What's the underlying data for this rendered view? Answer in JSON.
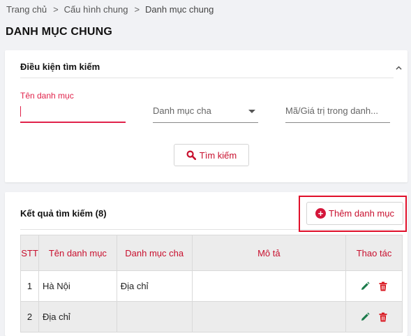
{
  "breadcrumb": {
    "home": "Trang chủ",
    "config": "Cấu hình chung",
    "current": "Danh mục chung",
    "separator": ">"
  },
  "page_title": "DANH MỤC CHUNG",
  "search": {
    "section_title": "Điều kiện tìm kiếm",
    "name_label": "Tên danh mục",
    "name_value": "",
    "parent_placeholder": "Danh mục cha",
    "code_placeholder": "Mã/Giá trị trong danh...",
    "search_button": "Tìm kiếm"
  },
  "results": {
    "title": "Kết quả tìm kiếm (8)",
    "add_button": "Thêm danh mục",
    "columns": [
      "STT",
      "Tên danh mục",
      "Danh mục cha",
      "Mô tả",
      "Thao tác"
    ],
    "rows": [
      {
        "stt": "1",
        "name": "Hà Nội",
        "parent": "Địa chỉ",
        "desc": ""
      },
      {
        "stt": "2",
        "name": "Địa chỉ",
        "parent": "",
        "desc": ""
      }
    ]
  },
  "colors": {
    "accent": "#c8102e",
    "highlight_box": "#e0102a",
    "edit_icon": "#1b7a4a",
    "background": "#f1f2f5"
  },
  "icons": {
    "collapse": "chevron-up-icon",
    "search": "magnifier-icon",
    "add": "plus-circle-icon",
    "edit": "pencil-icon",
    "delete": "trash-icon",
    "dropdown": "caret-down-icon"
  }
}
